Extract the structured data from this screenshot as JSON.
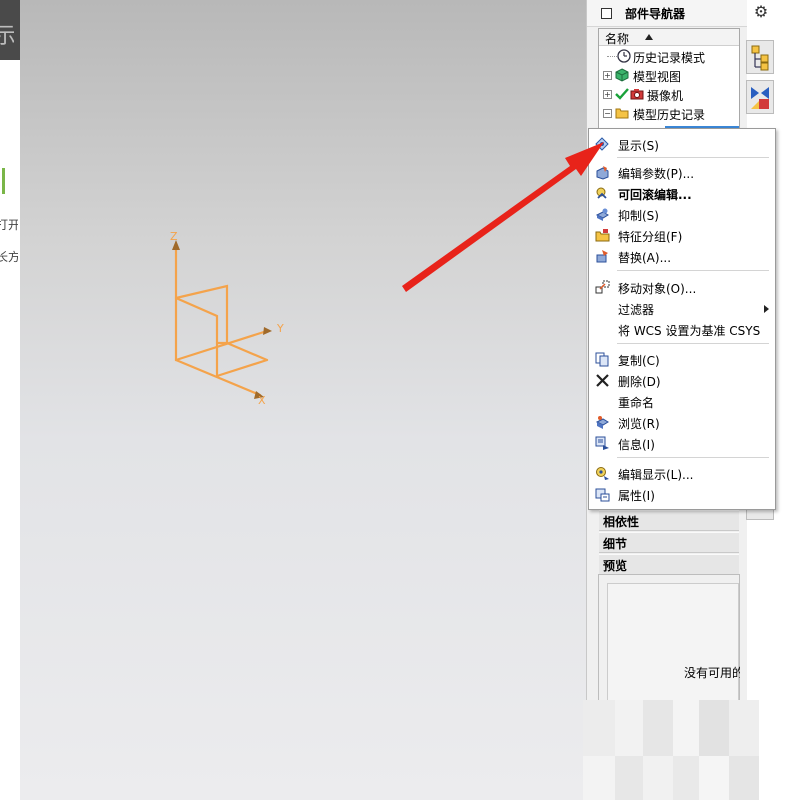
{
  "background_fragments": {
    "title_glyph": "示",
    "line1": "打开",
    "line2": "长方"
  },
  "triad": {
    "z_label": "Z",
    "y_label": "Y",
    "x_label": "X",
    "color": "#f4a34b"
  },
  "navigator": {
    "title": "部件导航器",
    "column_header": "名称",
    "items": [
      {
        "label": "历史记录模式"
      },
      {
        "label": "模型视图",
        "expand": "+"
      },
      {
        "label": "摄像机",
        "expand": "+"
      },
      {
        "label": "模型历史记录",
        "expand": "−"
      }
    ],
    "sections": [
      "相依性",
      "细节",
      "预览"
    ],
    "preview_text": "没有可用的"
  },
  "context_menu": {
    "items": [
      {
        "label": "显示(S)",
        "icon": "display-icon"
      },
      {
        "label": "编辑参数(P)...",
        "icon": "edit-parameters-icon"
      },
      {
        "label": "可回滚编辑...",
        "icon": "rollback-edit-icon",
        "bold": true
      },
      {
        "label": "抑制(S)",
        "icon": "suppress-icon"
      },
      {
        "label": "特征分组(F)",
        "icon": "feature-group-icon"
      },
      {
        "label": "替换(A)...",
        "icon": "replace-icon"
      },
      {
        "label": "移动对象(O)...",
        "icon": "move-object-icon"
      },
      {
        "label": "过滤器",
        "submenu": true
      },
      {
        "label": "将 WCS 设置为基准 CSYS"
      },
      {
        "label": "复制(C)",
        "icon": "copy-icon"
      },
      {
        "label": "删除(D)",
        "icon": "delete-icon"
      },
      {
        "label": "重命名"
      },
      {
        "label": "浏览(R)",
        "icon": "browse-icon"
      },
      {
        "label": "信息(I)",
        "icon": "info-icon"
      },
      {
        "label": "编辑显示(L)...",
        "icon": "edit-display-icon"
      },
      {
        "label": "属性(I)",
        "icon": "properties-icon"
      }
    ]
  },
  "annotation": {
    "arrow_color": "#e8231a"
  }
}
